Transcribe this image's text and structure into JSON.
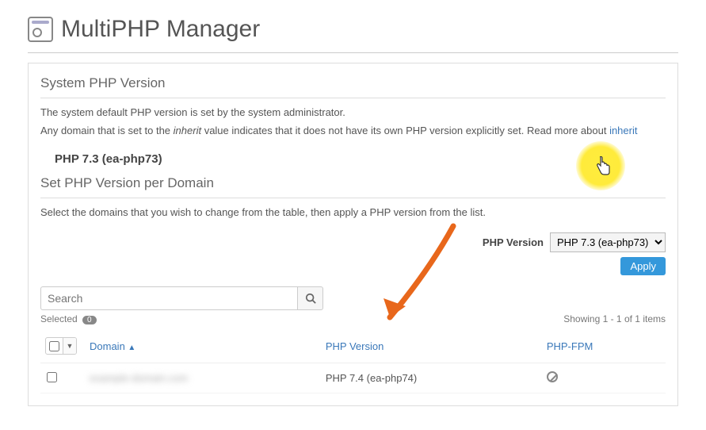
{
  "page_title": "MultiPHP Manager",
  "system": {
    "section_title": "System PHP Version",
    "desc1": "The system default PHP version is set by the system administrator.",
    "desc2a": "Any domain that is set to the ",
    "desc2_em": "inherit",
    "desc2b": " value indicates that it does not have its own PHP version explicitly set. Read more about ",
    "inherit_link": "inherit",
    "current_version": "PHP 7.3 (ea-php73)"
  },
  "per_domain": {
    "section_title": "Set PHP Version per Domain",
    "desc": "Select the domains that you wish to change from the table, then apply a PHP version from the list.",
    "version_label": "PHP Version",
    "version_selected": "PHP 7.3 (ea-php73)",
    "apply_label": "Apply",
    "search_placeholder": "Search",
    "selected_label": "Selected",
    "selected_count": "0",
    "showing_prefix": "Showing ",
    "showing_range": "1 - 1",
    "showing_mid": " of ",
    "showing_total": "1",
    "showing_suffix": " items"
  },
  "table": {
    "headers": {
      "domain": "Domain",
      "domain_sort": "▲",
      "php_version": "PHP Version",
      "php_fpm": "PHP-FPM"
    },
    "row": {
      "domain_blur": "example-domain.com",
      "php_version": "PHP 7.4 (ea-php74)"
    }
  }
}
